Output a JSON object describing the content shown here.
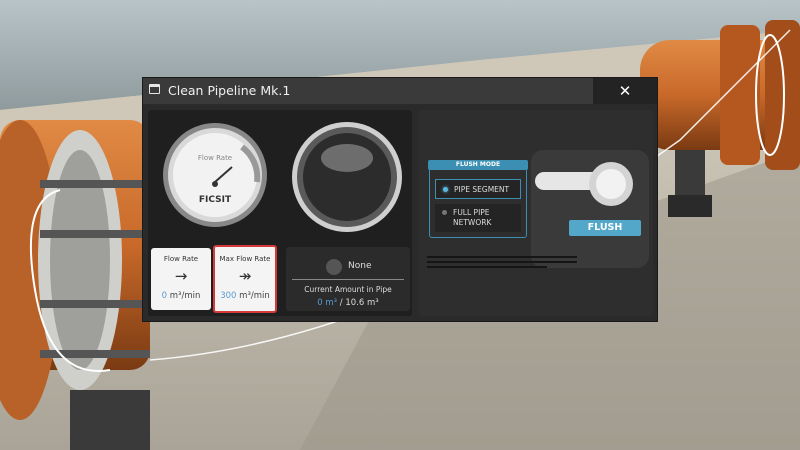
{
  "window": {
    "title": "Clean Pipeline Mk.1",
    "close_label": "✕"
  },
  "gauge": {
    "label": "Flow Rate",
    "brand": "FICSIT",
    "fill_fraction": 0.0
  },
  "flow_rate": {
    "label": "Flow Rate",
    "arrow": "→",
    "value": "0",
    "unit": " m³/min"
  },
  "max_flow_rate": {
    "label": "Max Flow Rate",
    "arrow": "↠",
    "value": "300",
    "unit": " m³/min"
  },
  "fluid": {
    "name": "None",
    "current_label": "Current Amount in Pipe",
    "current_value": "0 m³",
    "capacity": " / 10.6 m³"
  },
  "flush_mode": {
    "title": "FLUSH MODE",
    "options": [
      "PIPE SEGMENT",
      "FULL PIPE NETWORK"
    ],
    "option2_line1": "FULL PIPE",
    "option2_line2": "NETWORK",
    "selected": "PIPE SEGMENT"
  },
  "flush_button": {
    "label": "FLUSH"
  },
  "colors": {
    "accent": "#53a7c9",
    "highlight_border": "#d43a3a",
    "pipe": "#c8692a"
  }
}
